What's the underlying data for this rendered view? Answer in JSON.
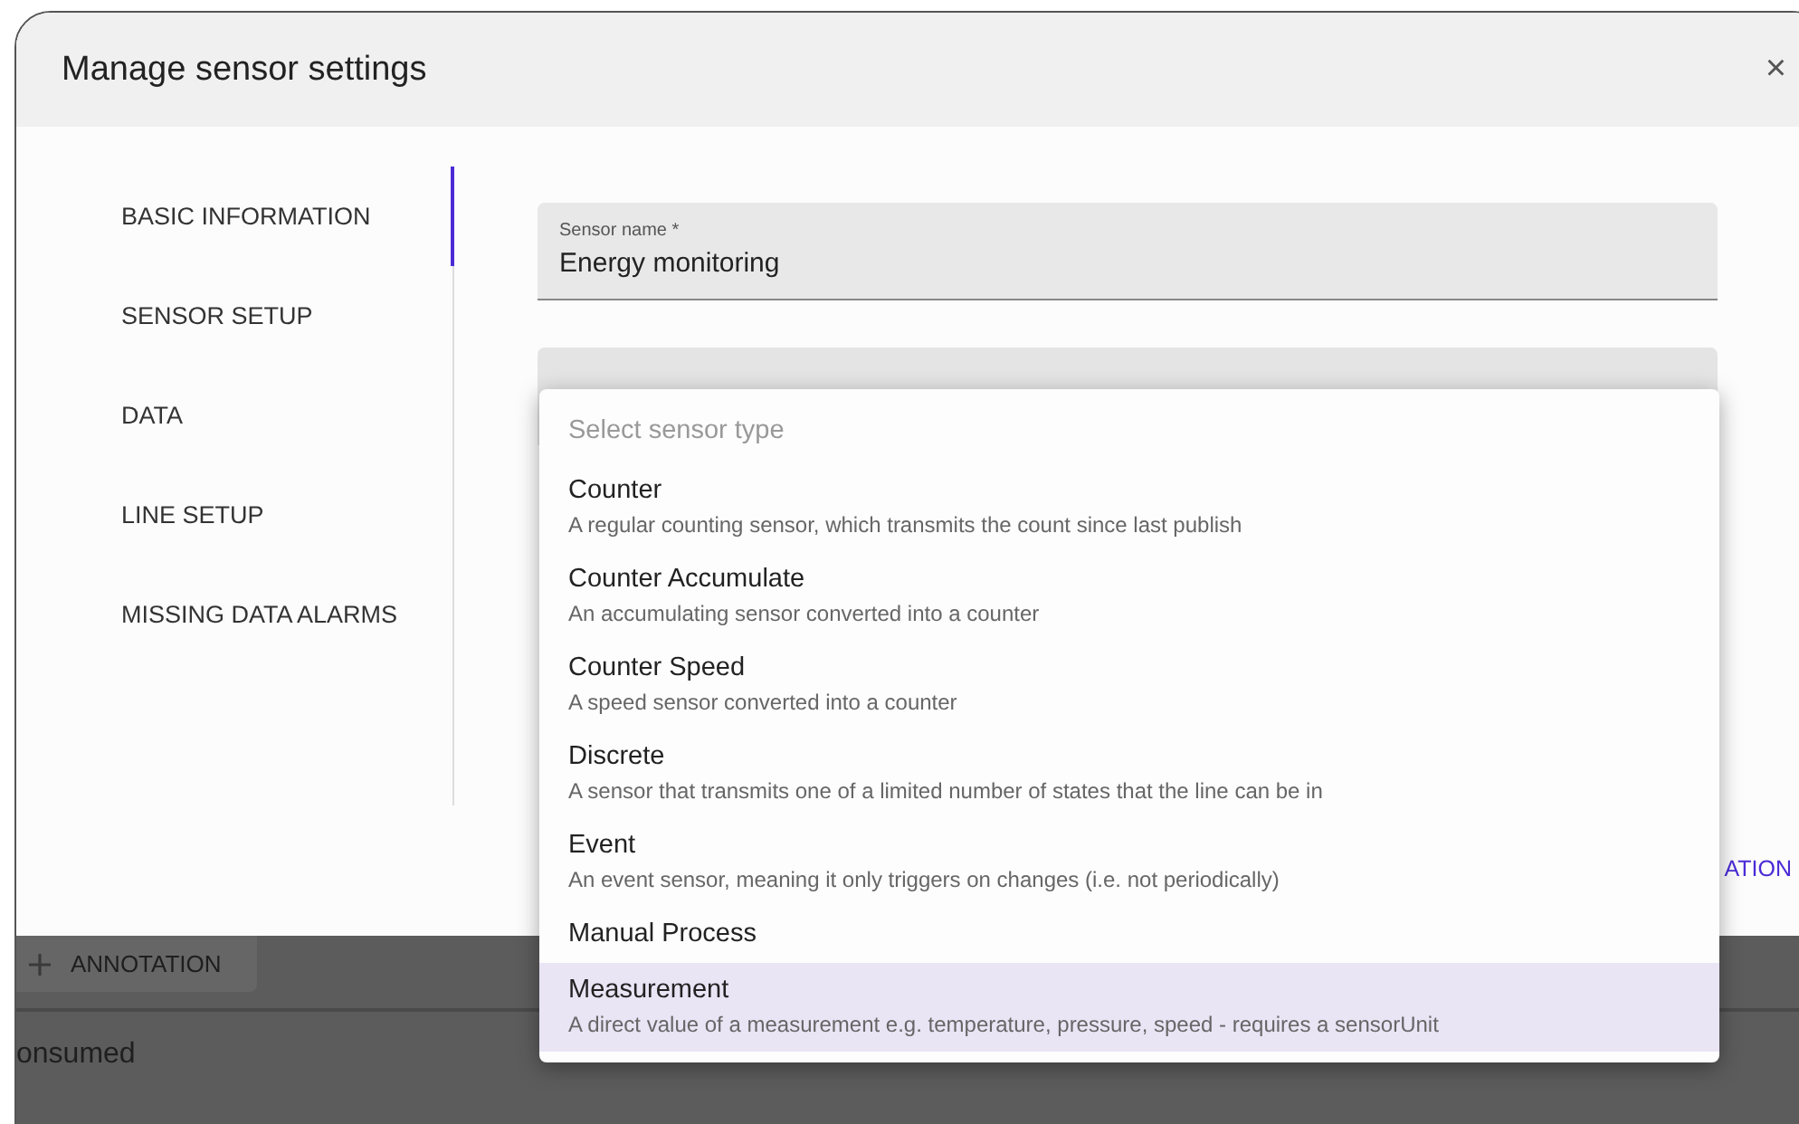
{
  "dialog": {
    "title": "Manage sensor settings",
    "close": "×"
  },
  "nav": [
    {
      "label": "BASIC INFORMATION",
      "selected": true
    },
    {
      "label": "SENSOR SETUP",
      "selected": false
    },
    {
      "label": "DATA",
      "selected": false
    },
    {
      "label": "LINE SETUP",
      "selected": false
    },
    {
      "label": "MISSING DATA ALARMS",
      "selected": false
    }
  ],
  "sensor_name_field": {
    "label": "Sensor name *",
    "value": "Energy monitoring"
  },
  "footer_button": {
    "label": "ATION"
  },
  "dropdown": {
    "placeholder": "Select sensor type",
    "options": [
      {
        "title": "Counter",
        "description": "A regular counting sensor, which transmits the count since last publish",
        "selected": false
      },
      {
        "title": "Counter Accumulate",
        "description": "An accumulating sensor converted into a counter",
        "selected": false
      },
      {
        "title": "Counter Speed",
        "description": "A speed sensor converted into a counter",
        "selected": false
      },
      {
        "title": "Discrete",
        "description": "A sensor that transmits one of a limited number of states that the line can be in",
        "selected": false
      },
      {
        "title": "Event",
        "description": "An event sensor, meaning it only triggers on changes (i.e. not periodically)",
        "selected": false
      },
      {
        "title": "Manual Process",
        "selected": false
      },
      {
        "title": "Measurement",
        "description": "A direct value of a measurement e.g. temperature, pressure, speed - requires a sensorUnit",
        "selected": true
      }
    ]
  },
  "background": {
    "annotation_button": "ANNOTATION",
    "row_text": "onsumed"
  }
}
